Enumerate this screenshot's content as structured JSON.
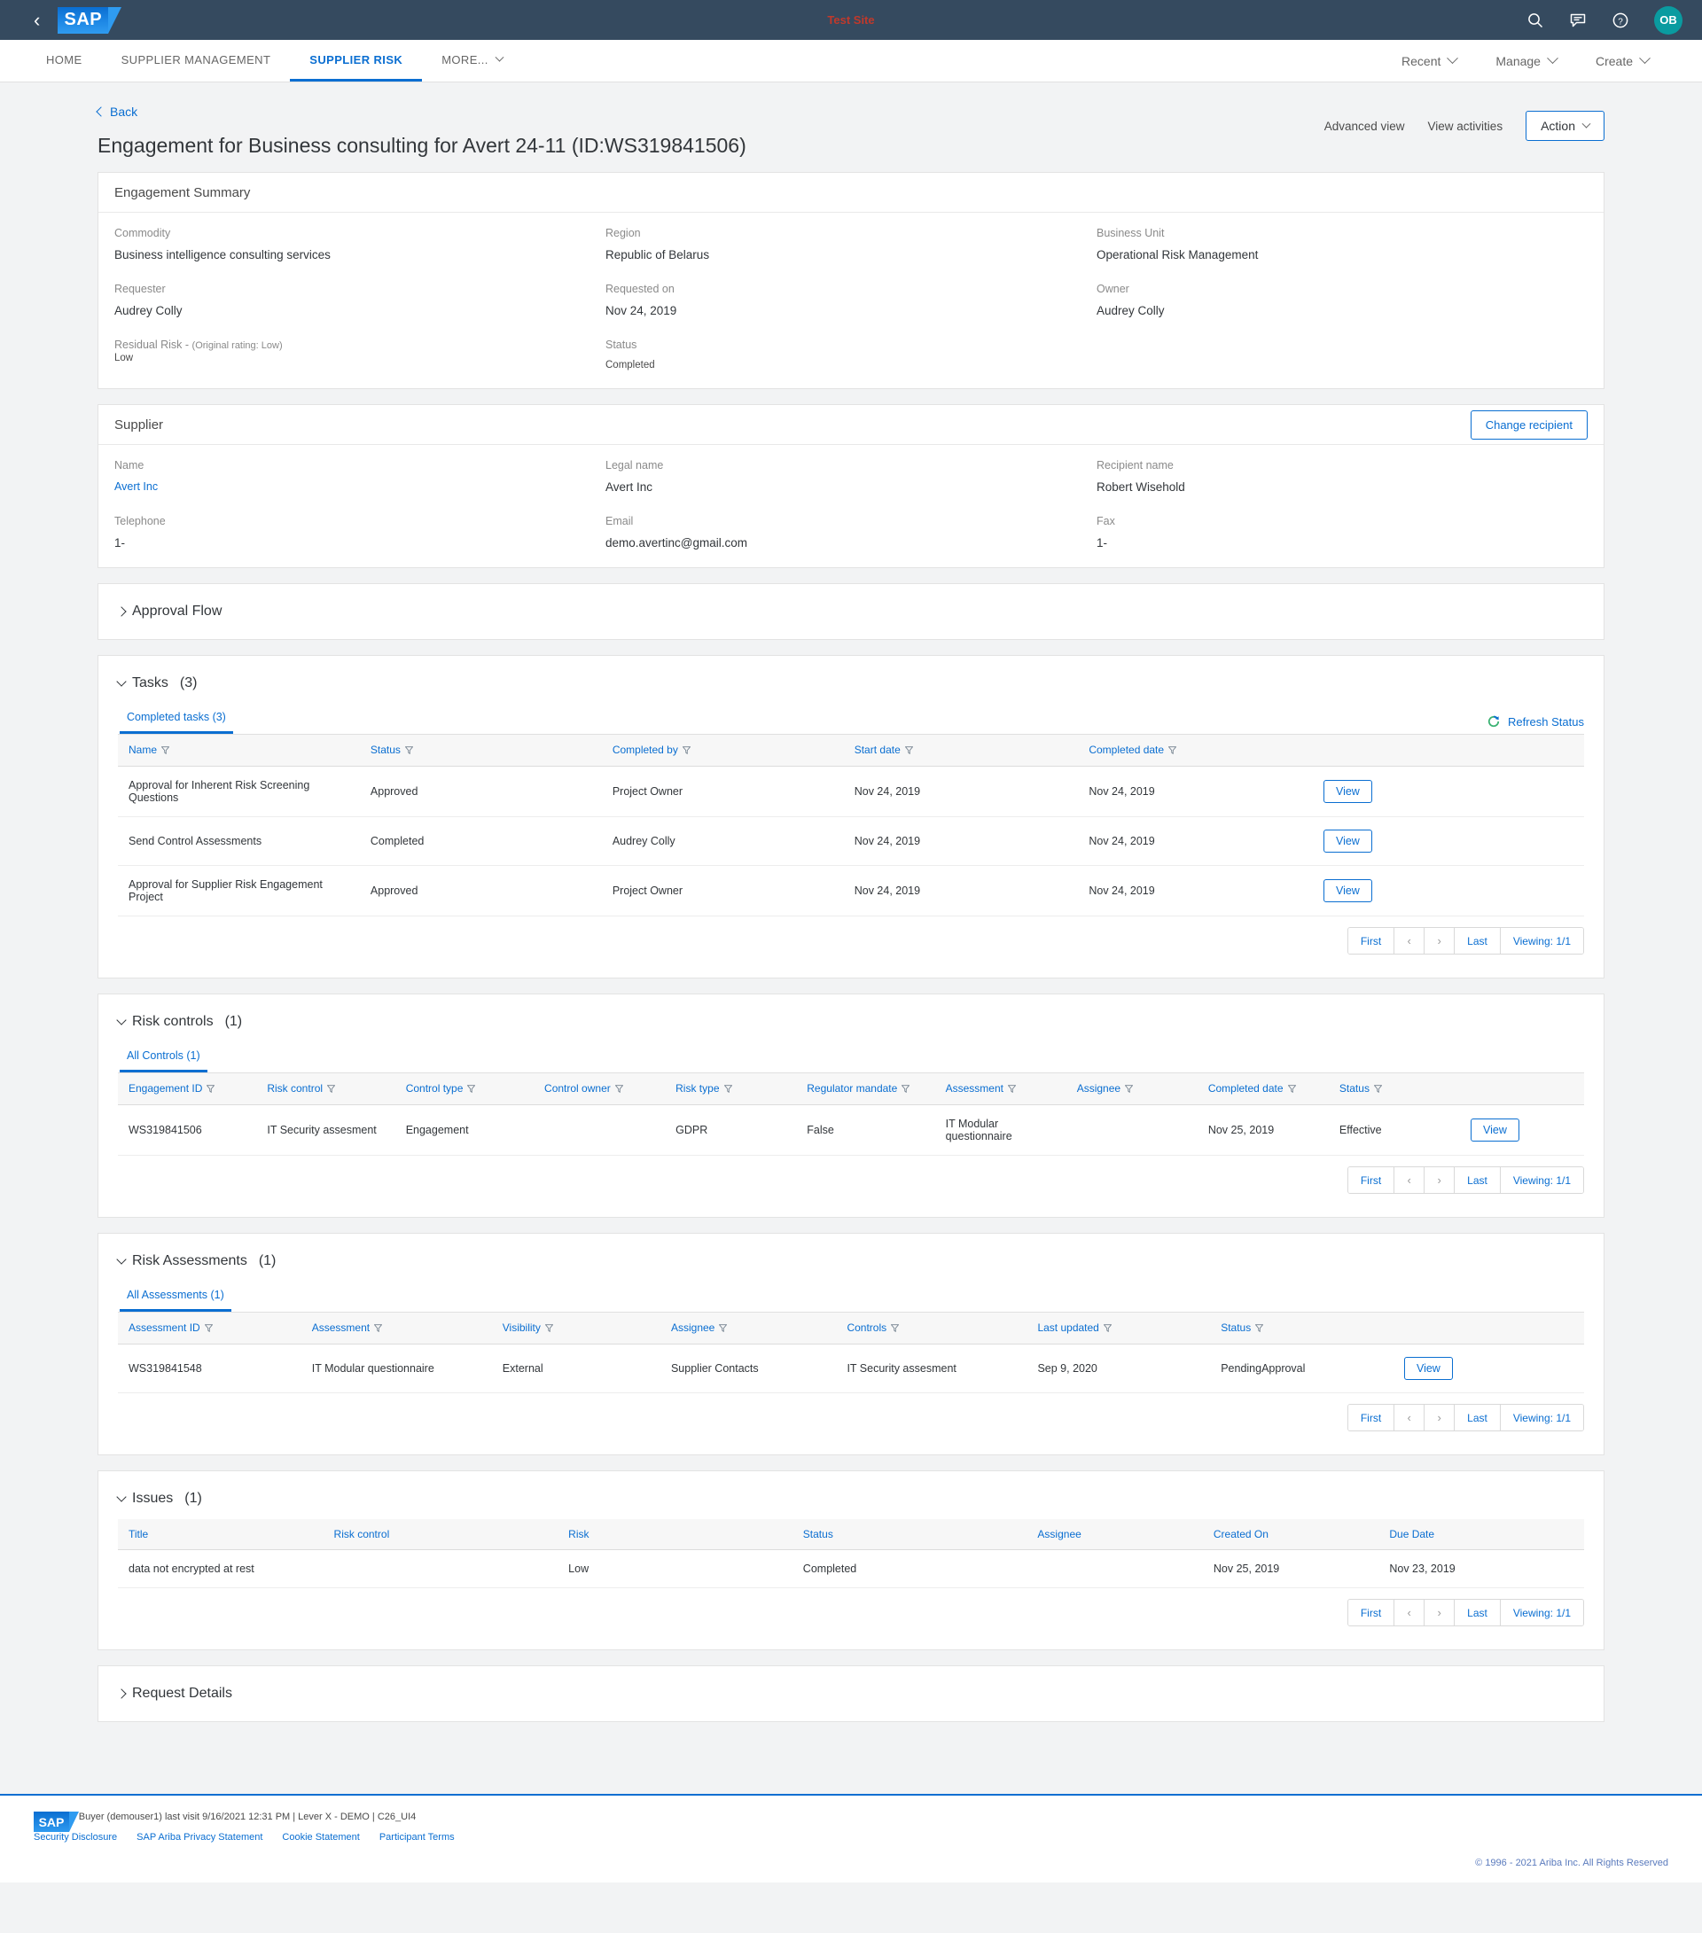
{
  "topbar": {
    "back_icon": "chevron-left-icon",
    "logo_text": "SAP",
    "test_site_label": "Test Site",
    "icons": [
      "search-icon",
      "feedback-icon",
      "help-icon"
    ],
    "avatar_initials": "OB",
    "realm_label": "Lever X - DEMO"
  },
  "nav": {
    "items": [
      {
        "label": "HOME",
        "active": false
      },
      {
        "label": "SUPPLIER MANAGEMENT",
        "active": false
      },
      {
        "label": "SUPPLIER RISK",
        "active": true
      },
      {
        "label": "MORE...",
        "active": false
      }
    ],
    "right_menus": [
      {
        "label": "Recent"
      },
      {
        "label": "Manage"
      },
      {
        "label": "Create"
      }
    ]
  },
  "header": {
    "back_label": "Back",
    "title": "Engagement for Business consulting for Avert 24-11 (ID:WS319841506)",
    "advanced_view": "Advanced view",
    "view_activities": "View activities",
    "action_button": "Action"
  },
  "engagement_summary": {
    "title": "Engagement Summary",
    "fields": [
      {
        "label": "Commodity",
        "value": "Business intelligence consulting services"
      },
      {
        "label": "Region",
        "value": "Republic of Belarus"
      },
      {
        "label": "Business Unit",
        "value": "Operational Risk Management"
      },
      {
        "label": "Requester",
        "value": "Audrey Colly"
      },
      {
        "label": "Requested on",
        "value": "Nov 24, 2019"
      },
      {
        "label": "Owner",
        "value": "Audrey Colly"
      }
    ],
    "residual_risk_label": "Residual Risk - ",
    "residual_risk_sub": "(Original rating: Low)",
    "residual_risk_value": "Low",
    "status_label": "Status",
    "status_value": "Completed"
  },
  "supplier": {
    "title": "Supplier",
    "change_recipient_label": "Change recipient",
    "name_label": "Name",
    "name_value": "Avert Inc",
    "legal_name_label": "Legal name",
    "legal_name_value": "Avert Inc",
    "recipient_label": "Recipient name",
    "recipient_value": "Robert Wisehold",
    "telephone_label": "Telephone",
    "telephone_value": "1-",
    "email_label": "Email",
    "email_value": "demo.avertinc@gmail.com",
    "fax_label": "Fax",
    "fax_value": "1-"
  },
  "approval_flow": {
    "title": "Approval Flow"
  },
  "request_details": {
    "title": "Request Details"
  },
  "tasks": {
    "title": "Tasks",
    "count": "(3)",
    "tab_label": "Completed tasks (3)",
    "refresh_label": "Refresh Status",
    "columns": [
      "Name",
      "Status",
      "Completed by",
      "Start date",
      "Completed date",
      ""
    ],
    "rows": [
      {
        "name": "Approval for Inherent Risk Screening Questions",
        "status": "Approved",
        "completed_by": "Project Owner",
        "start_date": "Nov 24, 2019",
        "completed_date": "Nov 24, 2019",
        "action": "View"
      },
      {
        "name": "Send Control Assessments",
        "status": "Completed",
        "completed_by": "Audrey Colly",
        "start_date": "Nov 24, 2019",
        "completed_date": "Nov 24, 2019",
        "action": "View"
      },
      {
        "name": "Approval for Supplier Risk Engagement Project",
        "status": "Approved",
        "completed_by": "Project Owner",
        "start_date": "Nov 24, 2019",
        "completed_date": "Nov 24, 2019",
        "action": "View"
      }
    ],
    "pager": {
      "first": "First",
      "prev": "‹",
      "next": "›",
      "last": "Last",
      "viewing": "Viewing: 1/1"
    }
  },
  "risk_controls": {
    "title": "Risk controls",
    "count": "(1)",
    "tab_label": "All Controls (1)",
    "columns": [
      "Engagement ID",
      "Risk control",
      "Control type",
      "Control owner",
      "Risk type",
      "Regulator mandate",
      "Assessment",
      "Assignee",
      "Completed date",
      "Status",
      ""
    ],
    "rows": [
      {
        "engagement_id": "WS319841506",
        "risk_control": "IT Security assesment",
        "control_type": "Engagement",
        "control_owner": "",
        "risk_type": "GDPR",
        "regulator_mandate": "False",
        "assessment": "IT Modular questionnaire",
        "assignee": "",
        "completed_date": "Nov 25, 2019",
        "status": "Effective",
        "action": "View"
      }
    ],
    "pager": {
      "first": "First",
      "prev": "‹",
      "next": "›",
      "last": "Last",
      "viewing": "Viewing: 1/1"
    }
  },
  "risk_assessments": {
    "title": "Risk Assessments",
    "count": "(1)",
    "tab_label": "All Assessments (1)",
    "columns": [
      "Assessment ID",
      "Assessment",
      "Visibility",
      "Assignee",
      "Controls",
      "Last updated",
      "Status",
      ""
    ],
    "rows": [
      {
        "assessment_id": "WS319841548",
        "assessment": "IT Modular questionnaire",
        "visibility": "External",
        "assignee": "Supplier Contacts",
        "controls": "IT Security assesment",
        "last_updated": "Sep 9, 2020",
        "status": "PendingApproval",
        "action": "View"
      }
    ],
    "pager": {
      "first": "First",
      "prev": "‹",
      "next": "›",
      "last": "Last",
      "viewing": "Viewing: 1/1"
    }
  },
  "issues": {
    "title": "Issues",
    "count": "(1)",
    "columns": [
      "Title",
      "Risk control",
      "Risk",
      "Status",
      "Assignee",
      "Created On",
      "Due Date"
    ],
    "rows": [
      {
        "title": "data not encrypted at rest",
        "risk_control": "",
        "risk": "Low",
        "status": "Completed",
        "assignee": "",
        "created_on": "Nov 25, 2019",
        "due_date": "Nov 23, 2019"
      }
    ],
    "pager": {
      "first": "First",
      "prev": "‹",
      "next": "›",
      "last": "Last",
      "viewing": "Viewing: 1/1"
    }
  },
  "footer": {
    "logo_text": "SAP",
    "info_line": "Operative Buyer (demouser1) last visit 9/16/2021 12:31 PM | Lever X - DEMO | C26_UI4",
    "links": [
      "Security Disclosure",
      "SAP Ariba Privacy Statement",
      "Cookie Statement",
      "Participant Terms"
    ],
    "copyright": "© 1996 - 2021 Ariba Inc. All Rights Reserved"
  },
  "colors": {
    "brand_blue": "#0a6ed1",
    "topbar_bg": "#354a5f",
    "accent_teal": "#0a9ba0",
    "test_red": "#c0392b"
  }
}
